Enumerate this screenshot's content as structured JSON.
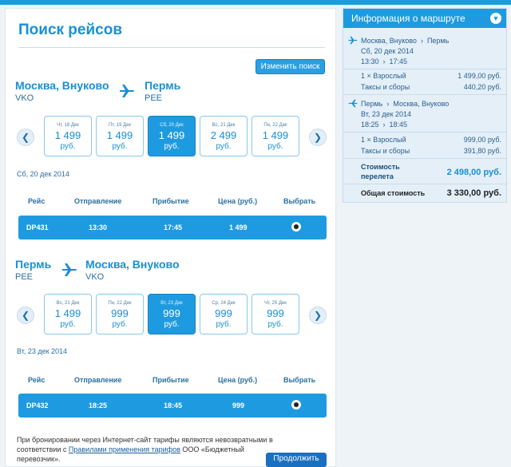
{
  "page": {
    "title": "Поиск рейсов",
    "modify_button": "Изменить поиск",
    "note_line1": "При бронировании через Интернет-сайт тарифы являются невозвратными в",
    "note_line2_pre": "соответствии с",
    "note_link": "Правилами применения тарифов",
    "note_line2_post": "ООО «Бюджетный перевозчик».",
    "continue_button": "Продолжить"
  },
  "table_headers": {
    "flight": "Рейс",
    "departure": "Отправление",
    "arrival": "Прибытие",
    "price": "Цена (руб.)",
    "select": "Выбрать"
  },
  "outbound": {
    "from_city": "Москва, Внуково",
    "from_code": "VKO",
    "to_city": "Пермь",
    "to_code": "PEE",
    "dates": [
      {
        "label": "Чт, 18 Дек",
        "price": "1 499",
        "currency": "руб."
      },
      {
        "label": "Пт, 19 Дек",
        "price": "1 499",
        "currency": "руб."
      },
      {
        "label": "Сб, 20 Дек",
        "price": "1 499",
        "currency": "руб."
      },
      {
        "label": "Вс, 21 Дек",
        "price": "2 499",
        "currency": "руб."
      },
      {
        "label": "Пн, 22 Дек",
        "price": "1 499",
        "currency": "руб."
      }
    ],
    "selected_index": 2,
    "date_text": "Сб, 20 дек 2014",
    "flight": {
      "number": "DP431",
      "departure": "13:30",
      "arrival": "17:45",
      "price": "1 499"
    }
  },
  "inbound": {
    "from_city": "Пермь",
    "from_code": "PEE",
    "to_city": "Москва, Внуково",
    "to_code": "VKO",
    "dates": [
      {
        "label": "Вс, 21 Дек",
        "price": "1 499",
        "currency": "руб."
      },
      {
        "label": "Пн, 22 Дек",
        "price": "999",
        "currency": "руб."
      },
      {
        "label": "Вт, 23 Дек",
        "price": "999",
        "currency": "руб."
      },
      {
        "label": "Ср, 24 Дек",
        "price": "999",
        "currency": "руб."
      },
      {
        "label": "Чт, 25 Дек",
        "price": "999",
        "currency": "руб."
      }
    ],
    "selected_index": 2,
    "date_text": "Вт, 23 дек 2014",
    "flight": {
      "number": "DP432",
      "departure": "18:25",
      "arrival": "18:45",
      "price": "999"
    }
  },
  "sidebar": {
    "title": "Информация о маршруте",
    "leg1": {
      "from": "Москва, Внуково",
      "to": "Пермь",
      "date": "Сб, 20 дек 2014",
      "dep": "13:30",
      "arr": "17:45",
      "pax_label": "1 × Взрослый",
      "pax_value": "1 499,00 руб.",
      "tax_label": "Таксы и сборы",
      "tax_value": "440,20 руб."
    },
    "leg2": {
      "from": "Пермь",
      "to": "Москва, Внуково",
      "date": "Вт, 23 дек 2014",
      "dep": "18:25",
      "arr": "18:45",
      "pax_label": "1 × Взрослый",
      "pax_value": "999,00 руб.",
      "tax_label": "Таксы и сборы",
      "tax_value": "391,80 руб."
    },
    "fare_label_1": "Стоимость",
    "fare_label_2": "перелета",
    "fare_value": "2 498,00 руб.",
    "total_label": "Общая стоимость",
    "total_value": "3 330,00 руб."
  }
}
